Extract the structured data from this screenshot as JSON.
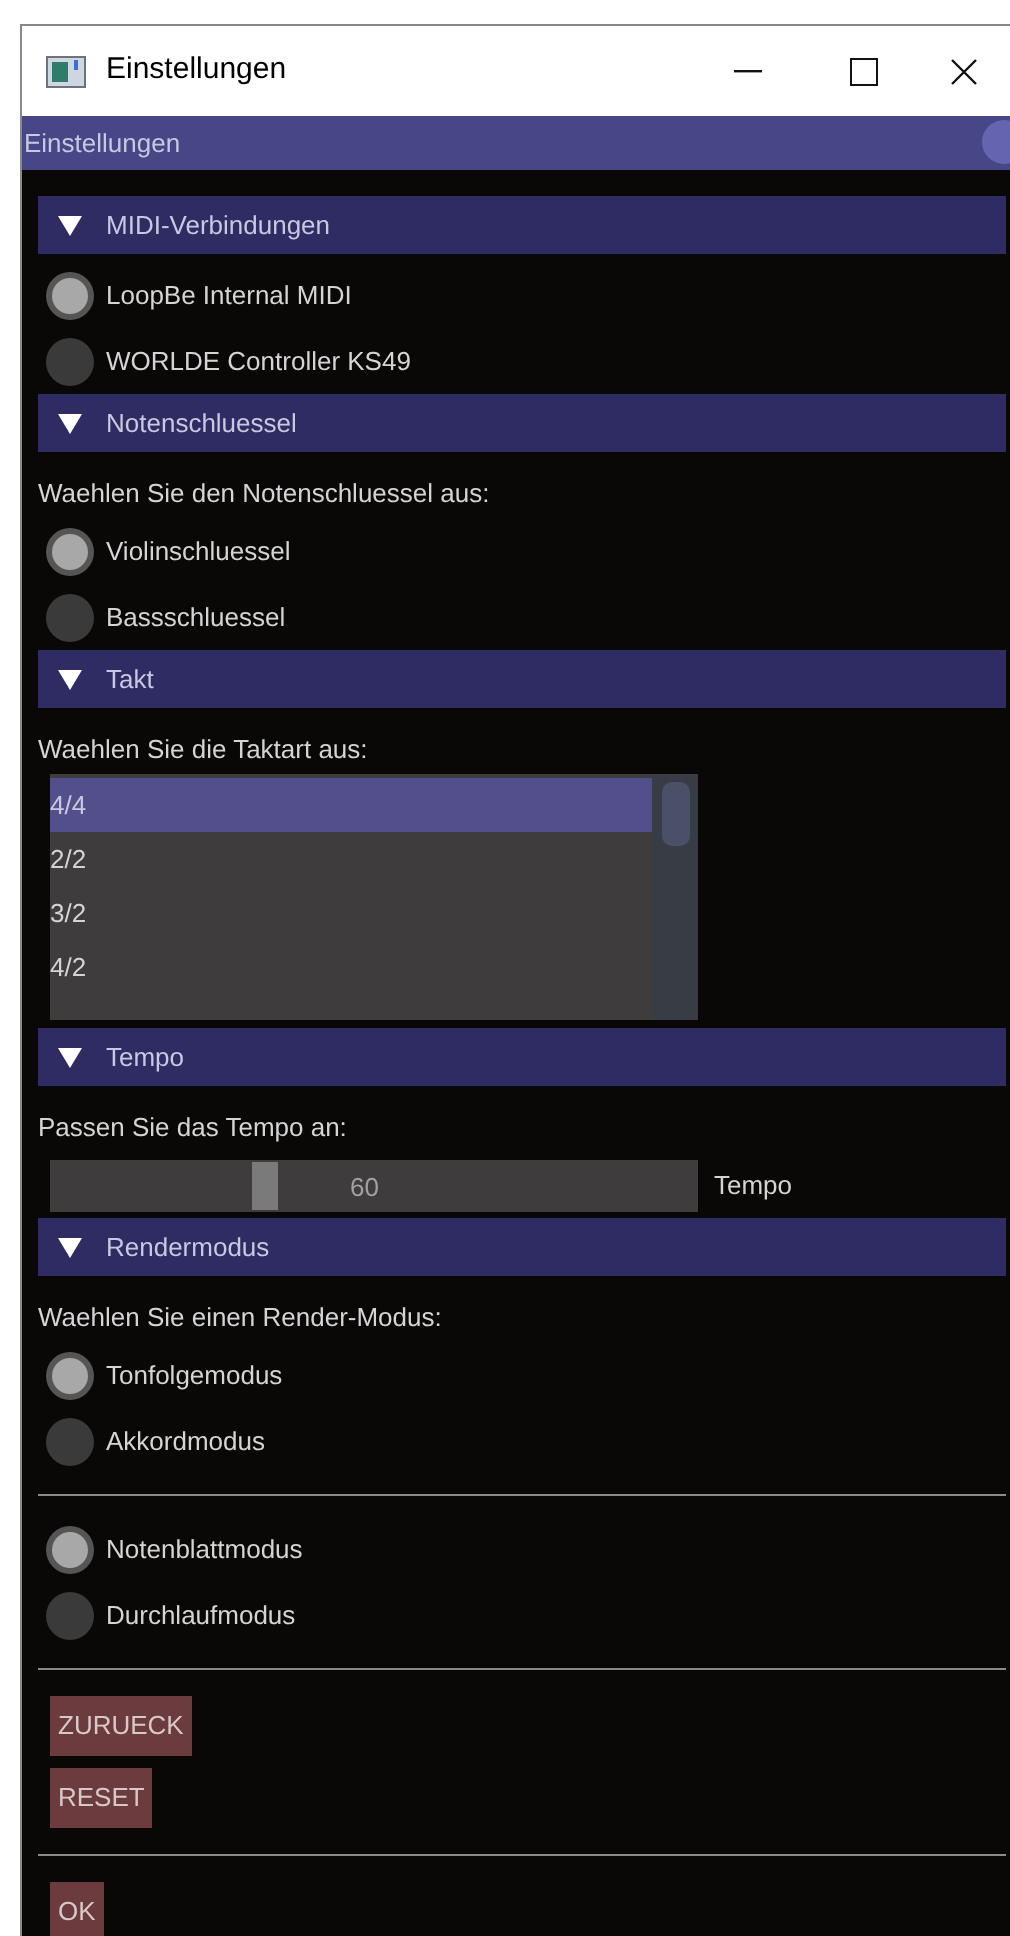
{
  "window": {
    "title": "Einstellungen"
  },
  "panel": {
    "title": "Einstellungen"
  },
  "sections": [
    {
      "title": "MIDI-Verbindungen",
      "expanded": true,
      "items": [
        {
          "kind": "radio",
          "label": "LoopBe Internal MIDI",
          "selected": true
        },
        {
          "kind": "radio",
          "label": "WORLDE Controller KS49",
          "selected": false
        }
      ]
    },
    {
      "title": "Notenschluessel",
      "expanded": true,
      "items": [
        {
          "kind": "label",
          "label": "Waehlen Sie den Notenschluessel aus:"
        },
        {
          "kind": "radio",
          "label": "Violinschluessel",
          "selected": true
        },
        {
          "kind": "radio",
          "label": "Bassschluessel",
          "selected": false
        }
      ]
    },
    {
      "title": "Takt",
      "expanded": true,
      "items": [
        {
          "kind": "label",
          "label": "Waehlen Sie die Taktart aus:"
        },
        {
          "kind": "listbox",
          "options": [
            {
              "label": "4/4",
              "selected": true
            },
            {
              "label": "2/2",
              "selected": false
            },
            {
              "label": "3/2",
              "selected": false
            },
            {
              "label": "4/2",
              "selected": false
            }
          ]
        }
      ]
    },
    {
      "title": "Tempo",
      "expanded": true,
      "items": [
        {
          "kind": "label",
          "label": "Passen Sie das Tempo an:"
        },
        {
          "kind": "slider",
          "label": "Tempo",
          "reading": "60",
          "level": 0.33
        }
      ]
    },
    {
      "title": "Rendermodus",
      "expanded": true,
      "items": [
        {
          "kind": "label",
          "label": "Waehlen Sie einen Render-Modus:"
        },
        {
          "kind": "radio",
          "label": "Tonfolgemodus",
          "selected": true
        },
        {
          "kind": "radio",
          "label": "Akkordmodus",
          "selected": false
        },
        {
          "kind": "divider"
        },
        {
          "kind": "radio",
          "label": "Notenblattmodus",
          "selected": true
        },
        {
          "kind": "radio",
          "label": "Durchlaufmodus",
          "selected": false
        },
        {
          "kind": "divider"
        },
        {
          "kind": "button",
          "label": "ZURUECK"
        },
        {
          "kind": "button",
          "label": "RESET"
        },
        {
          "kind": "divider"
        },
        {
          "kind": "button",
          "label": "OK"
        }
      ]
    }
  ]
}
